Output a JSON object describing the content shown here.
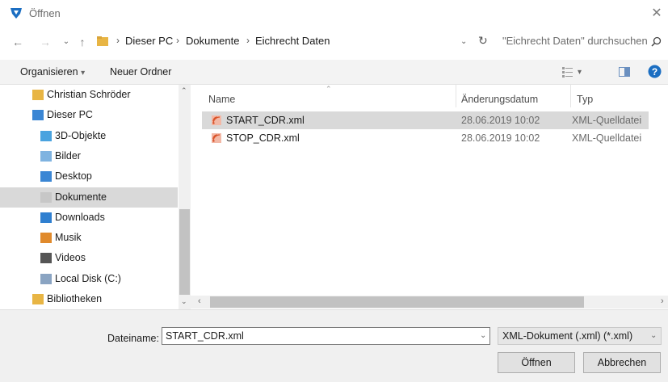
{
  "window": {
    "title": "Öffnen"
  },
  "nav": {
    "breadcrumbs": [
      "Dieser PC",
      "Dokumente",
      "Eichrecht Daten"
    ],
    "search_placeholder": "\"Eichrecht Daten\" durchsuchen"
  },
  "toolbar": {
    "organize_label": "Organisieren",
    "new_folder_label": "Neuer Ordner"
  },
  "sidebar": {
    "items": [
      {
        "label": "Christian Schröder",
        "icon": "user-folder-icon"
      },
      {
        "label": "Dieser PC",
        "icon": "computer-icon"
      },
      {
        "label": "3D-Objekte",
        "icon": "3d-objects-icon"
      },
      {
        "label": "Bilder",
        "icon": "pictures-icon"
      },
      {
        "label": "Desktop",
        "icon": "desktop-icon"
      },
      {
        "label": "Dokumente",
        "icon": "documents-icon",
        "selected": true
      },
      {
        "label": "Downloads",
        "icon": "downloads-icon"
      },
      {
        "label": "Musik",
        "icon": "music-icon"
      },
      {
        "label": "Videos",
        "icon": "videos-icon"
      },
      {
        "label": "Local Disk (C:)",
        "icon": "drive-icon"
      },
      {
        "label": "Bibliotheken",
        "icon": "libraries-icon"
      }
    ]
  },
  "file_list": {
    "columns": [
      "Name",
      "Änderungsdatum",
      "Typ"
    ],
    "rows": [
      {
        "name": "START_CDR.xml",
        "date": "28.06.2019 10:02",
        "type": "XML-Quelldatei",
        "selected": true
      },
      {
        "name": "STOP_CDR.xml",
        "date": "28.06.2019 10:02",
        "type": "XML-Quelldatei"
      }
    ]
  },
  "bottom": {
    "filename_label": "Dateiname:",
    "filename_value": "START_CDR.xml",
    "filter_value": "XML-Dokument (.xml) (*.xml)",
    "open_button": "Öffnen",
    "cancel_button": "Abbrechen"
  },
  "colors": {
    "accent_blue": "#1b6ec2",
    "selected_row": "#d9d9d9",
    "folder_yellow": "#e8b544"
  }
}
